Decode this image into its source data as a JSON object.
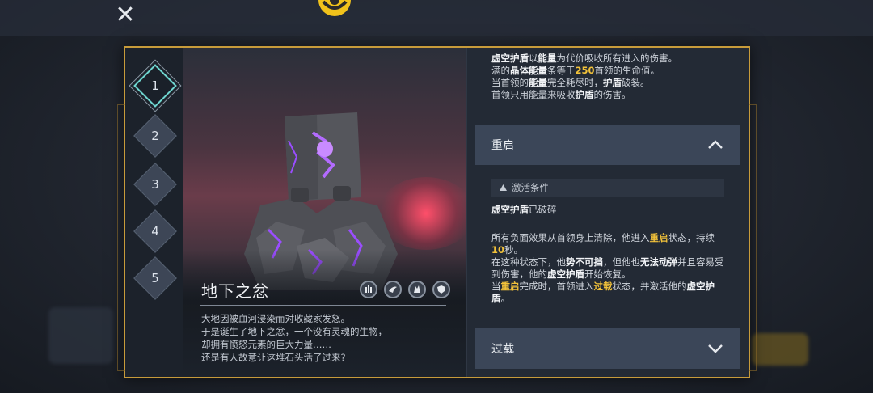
{
  "top_bar": {
    "close_symbol": "✕",
    "emblem_icon": "crest-icon"
  },
  "stages": [
    "1",
    "2",
    "3",
    "4",
    "5"
  ],
  "active_stage": 0,
  "boss": {
    "name": "地下之忿",
    "abilities": [
      "hand-icon",
      "wing-icon",
      "beast-icon",
      "shield-icon"
    ],
    "lore": [
      "大地因被血河浸染而对收藏家发怒。",
      "于是诞生了地下之忿，一个没有灵魂的生物，",
      "却拥有愤怒元素的巨大力量……",
      "还是有人故意让这堆石头活了过来?"
    ]
  },
  "void_shield": {
    "line1": {
      "a": "虚空护盾",
      "b": "以",
      "c": "能量",
      "d": "为代价吸收所有进入的伤害。"
    },
    "line2": {
      "a": "满的",
      "b": "晶体能量",
      "c": "条等于",
      "d": "250",
      "e": "首领的生命值。"
    },
    "line3": {
      "a": "当首领的",
      "b": "能量",
      "c": "完全耗尽时，",
      "d": "护盾",
      "e": "破裂。"
    },
    "line4": {
      "a": "首领只用能量来吸收",
      "b": "护盾",
      "c": "的伤害。"
    }
  },
  "reboot": {
    "title": "重启",
    "condition_label": "激活条件",
    "condition": {
      "a": "虚空护盾",
      "b": "已破碎"
    },
    "effect": {
      "p1": "所有负面效果从首领身上清除，他进入",
      "p1_kw": "重启",
      "p2": "状态，持续",
      "p2_num": "10",
      "p2_end": "秒。",
      "p3": "在这种状态下，他",
      "p3_kw1": "势不可挡",
      "p4": "，但他也",
      "p4_kw2": "无法动弹",
      "p5": "并且容易受到伤害，他的",
      "p5_kw3": "虚空护盾",
      "p6": "开始恢复。",
      "p7": "当",
      "p7_kw": "重启",
      "p8": "完成时，首领进入",
      "p8_kw": "过载",
      "p9": "状态，并激活他的",
      "p9_kw": "虚空护盾",
      "p10": "。"
    }
  },
  "overload": {
    "title": "过载"
  },
  "colors": {
    "accent_gold": "#c79b3a",
    "keyword_yellow": "#f2c23a",
    "active_cyan": "#6fd6d0",
    "void_purple": "#9a4dff"
  }
}
